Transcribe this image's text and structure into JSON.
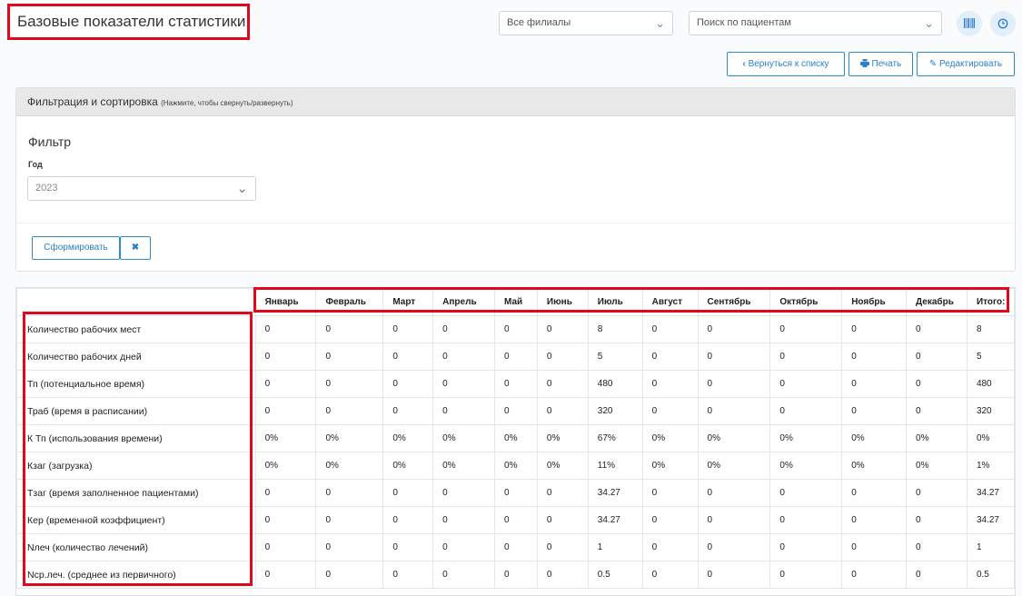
{
  "header": {
    "title": "Базовые показатели статистики",
    "branch_select": "Все филиалы",
    "patient_search_placeholder": "Поиск по пациентам"
  },
  "icons": {
    "barcode": "barcode-icon",
    "clock": "clock-icon",
    "chevron": "chevron-down-icon"
  },
  "toolbar": {
    "back_label": "Вернуться к списку",
    "print_label": "Печать",
    "edit_label": "Редактировать"
  },
  "filter_panel": {
    "title": "Фильтрация и сортировка",
    "hint": "(Нажмите, чтобы свернуть/развернуть)",
    "section_title": "Фильтр",
    "year_label": "Год",
    "year_value": "2023",
    "submit_label": "Сформировать",
    "clear_symbol": "✖"
  },
  "colors": {
    "accent": "#2d8ccf",
    "highlight": "#e3071d"
  },
  "table": {
    "columns": [
      "Январь",
      "Февраль",
      "Март",
      "Апрель",
      "Май",
      "Июнь",
      "Июль",
      "Август",
      "Сентябрь",
      "Октябрь",
      "Ноябрь",
      "Декабрь",
      "Итого:"
    ],
    "rows": [
      {
        "label": "Количество рабочих мест",
        "values": [
          "0",
          "0",
          "0",
          "0",
          "0",
          "0",
          "8",
          "0",
          "0",
          "0",
          "0",
          "0",
          "8"
        ]
      },
      {
        "label": "Количество рабочих дней",
        "values": [
          "0",
          "0",
          "0",
          "0",
          "0",
          "0",
          "5",
          "0",
          "0",
          "0",
          "0",
          "0",
          "5"
        ]
      },
      {
        "label": "Тп (потенциальное время)",
        "values": [
          "0",
          "0",
          "0",
          "0",
          "0",
          "0",
          "480",
          "0",
          "0",
          "0",
          "0",
          "0",
          "480"
        ]
      },
      {
        "label": "Траб (время в расписании)",
        "values": [
          "0",
          "0",
          "0",
          "0",
          "0",
          "0",
          "320",
          "0",
          "0",
          "0",
          "0",
          "0",
          "320"
        ]
      },
      {
        "label": "К Тп (использования времени)",
        "values": [
          "0%",
          "0%",
          "0%",
          "0%",
          "0%",
          "0%",
          "67%",
          "0%",
          "0%",
          "0%",
          "0%",
          "0%",
          "0%"
        ]
      },
      {
        "label": "Кзаг (загрузка)",
        "values": [
          "0%",
          "0%",
          "0%",
          "0%",
          "0%",
          "0%",
          "11%",
          "0%",
          "0%",
          "0%",
          "0%",
          "0%",
          "1%"
        ]
      },
      {
        "label": "Тзаг (время заполненное пациентами)",
        "values": [
          "0",
          "0",
          "0",
          "0",
          "0",
          "0",
          "34.27",
          "0",
          "0",
          "0",
          "0",
          "0",
          "34.27"
        ]
      },
      {
        "label": "Кер (временной коэффициент)",
        "values": [
          "0",
          "0",
          "0",
          "0",
          "0",
          "0",
          "34.27",
          "0",
          "0",
          "0",
          "0",
          "0",
          "34.27"
        ]
      },
      {
        "label": "Nлеч (количество лечений)",
        "values": [
          "0",
          "0",
          "0",
          "0",
          "0",
          "0",
          "1",
          "0",
          "0",
          "0",
          "0",
          "0",
          "1"
        ]
      },
      {
        "label": "Nср.леч. (среднее из первичного)",
        "values": [
          "0",
          "0",
          "0",
          "0",
          "0",
          "0",
          "0.5",
          "0",
          "0",
          "0",
          "0",
          "0",
          "0.5"
        ]
      }
    ]
  }
}
